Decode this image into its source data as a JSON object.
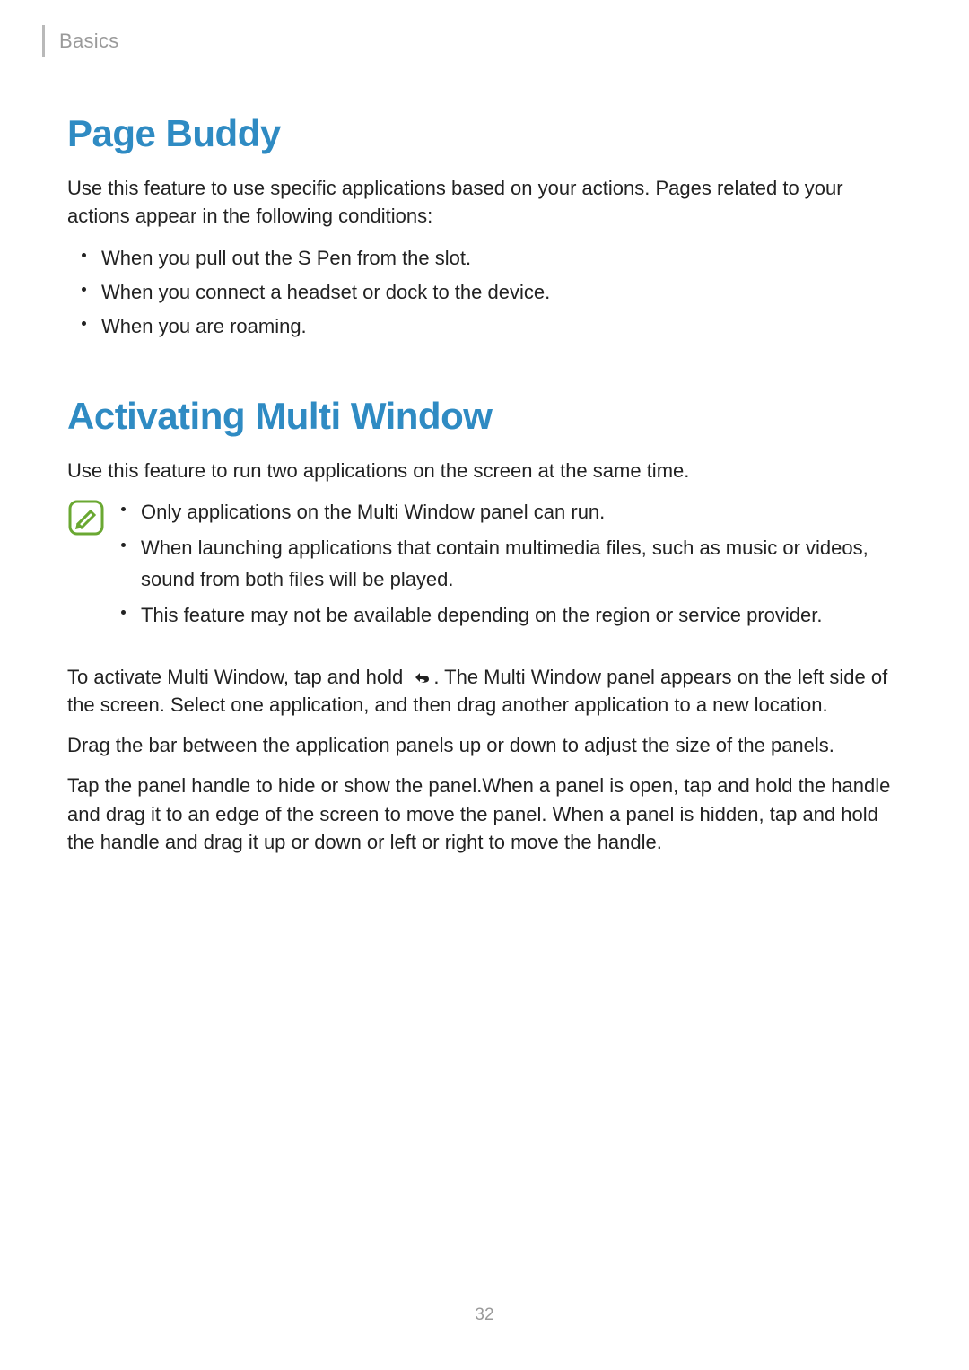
{
  "breadcrumb": "Basics",
  "pageNumber": "32",
  "section1": {
    "title": "Page Buddy",
    "intro": "Use this feature to use specific applications based on your actions. Pages related to your actions appear in the following conditions:",
    "bullets": [
      "When you pull out the S Pen from the slot.",
      "When you connect a headset or dock to the device.",
      "When you are roaming."
    ]
  },
  "section2": {
    "title": "Activating Multi Window",
    "intro": "Use this feature to run two applications on the screen at the same time.",
    "noteBullets": [
      "Only applications on the Multi Window panel can run.",
      "When launching applications that contain multimedia files, such as music or videos, sound from both files will be played.",
      "This feature may not be available depending on the region or service provider."
    ],
    "para1_a": "To activate Multi Window, tap and hold ",
    "para1_b": ". The Multi Window panel appears on the left side of the screen. Select one application, and then drag another application to a new location.",
    "para2": "Drag the bar between the application panels up or down to adjust the size of the panels.",
    "para3": "Tap the panel handle to hide or show the panel.When a panel is open, tap and hold the handle and drag it to an edge of the screen to move the panel. When a panel is hidden, tap and hold the handle and drag it up or down or left or right to move the handle."
  }
}
